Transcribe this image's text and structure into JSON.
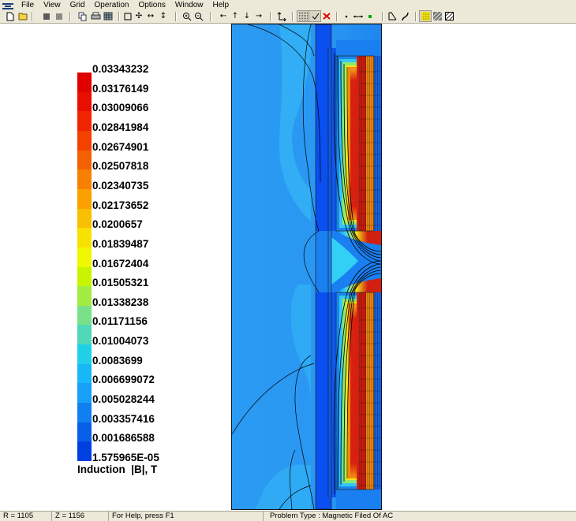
{
  "menu": [
    "File",
    "View",
    "Grid",
    "Operation",
    "Options",
    "Window",
    "Help"
  ],
  "toolbar_icons": [
    "new-file-icon",
    "open-file-icon",
    "dark-square-icon",
    "gray-square-icon",
    "copy-icon",
    "print-icon",
    "table-icon",
    "select-box-icon",
    "move-icon",
    "horizontal-arrows-icon",
    "vertical-arrows-icon",
    "zoom-in-icon",
    "zoom-out-icon",
    "arrow-left-icon",
    "arrow-up-icon",
    "arrow-down-icon",
    "arrow-right-icon",
    "axes-icon",
    "grid-dots-icon",
    "check-icon",
    "red-cross-icon",
    "dot-icon",
    "line-icon",
    "green-point-icon",
    "mesh-icon",
    "curve-icon",
    "yellow-grid-icon",
    "hatched-icon",
    "diagonal-hatch-icon"
  ],
  "legend": {
    "labels": [
      "0.03343232",
      "0.03176149",
      "0.03009066",
      "0.02841984",
      "0.02674901",
      "0.02507818",
      "0.02340735",
      "0.02173652",
      "0.0200657",
      "0.01839487",
      "0.01672404",
      "0.01505321",
      "0.01338238",
      "0.01171156",
      "0.01004073",
      "0.0083699",
      "0.006699072",
      "0.005028244",
      "0.003357416",
      "0.001686588",
      "1.575965E-05"
    ],
    "colors": [
      "#e00000",
      "#e80e00",
      "#f02400",
      "#f44000",
      "#f46000",
      "#f88000",
      "#fca000",
      "#f8c000",
      "#f8e000",
      "#f0f800",
      "#c8f400",
      "#a0ec40",
      "#78e088",
      "#50d8b8",
      "#20d0e8",
      "#18b8f8",
      "#18a0f8",
      "#1080f0",
      "#0860e8",
      "#0040e0"
    ],
    "title": "Induction  |B|, T"
  },
  "plot": {
    "colors": {
      "deep": "#0a4ff0",
      "mid": "#1a7ff0",
      "light": "#27b3f6",
      "cyan": "#33d0f6",
      "green": "#8fe870",
      "yellow": "#f6e61a",
      "orange": "#f08a10",
      "red": "#d22010"
    }
  },
  "status": {
    "r": "R = 1105",
    "z": "Z = 1156",
    "help": "For Help, press F1",
    "problem": "Problem Type :   Magnetic Filed Of AC"
  }
}
